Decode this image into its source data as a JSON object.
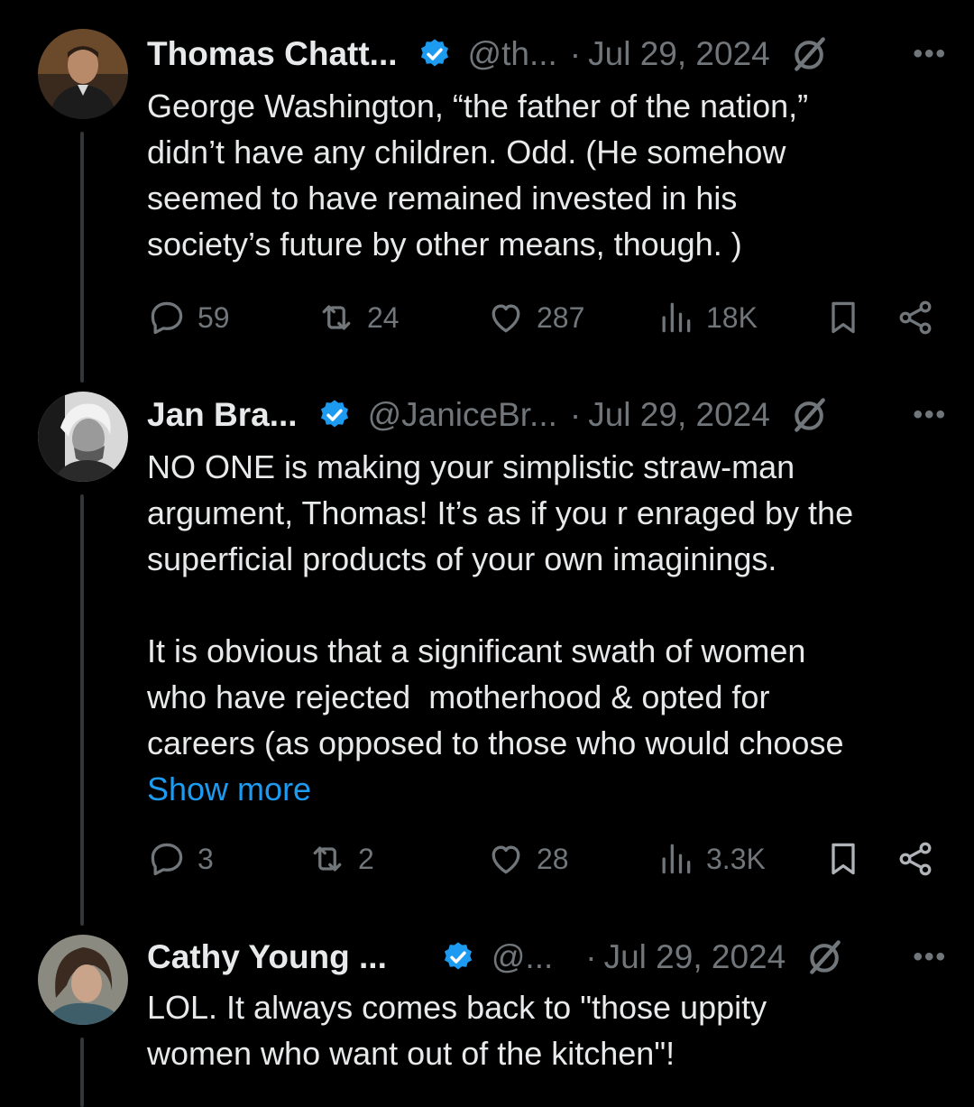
{
  "tweets": [
    {
      "name": "Thomas Chatt...",
      "handle": "@th...",
      "separator": "·",
      "date": "Jul 29, 2024",
      "more": "•••",
      "text": "George Washington, “the father of the nation,”\ndidn’t have any children. Odd. (He somehow\nseemed to have remained invested in his\nsociety’s future by other means, though. )",
      "show_more": "",
      "replies": "59",
      "reposts": "24",
      "likes": "287",
      "views": "18K",
      "verified_badge": "blue"
    },
    {
      "name": "Jan Bra...",
      "handle": "@JaniceBr...",
      "separator": "·",
      "date": "Jul 29, 2024",
      "more": "•••",
      "text": "NO ONE is making your simplistic straw-man\nargument, Thomas! It’s as if you r enraged by the\nsuperficial products of your own imaginings.\n\nIt is obvious that a significant swath of women\nwho have rejected  motherhood & opted for\ncareers (as opposed to those who would choose",
      "show_more": "Show more",
      "replies": "3",
      "reposts": "2",
      "likes": "28",
      "views": "3.3K",
      "verified_badge": "blue"
    },
    {
      "name": "Cathy Young ...",
      "handle": "@...",
      "separator": "·",
      "date": "Jul 29, 2024",
      "more": "•••",
      "text": "LOL. It always comes back to \"those uppity\nwomen who want out of the kitchen\"!",
      "show_more": "",
      "verified_badge": "blue"
    }
  ],
  "colors": {
    "background": "#000000",
    "text": "#e7e9ea",
    "muted": "#71767b",
    "link": "#1d9bf0",
    "verified": "#1d9bf0"
  }
}
